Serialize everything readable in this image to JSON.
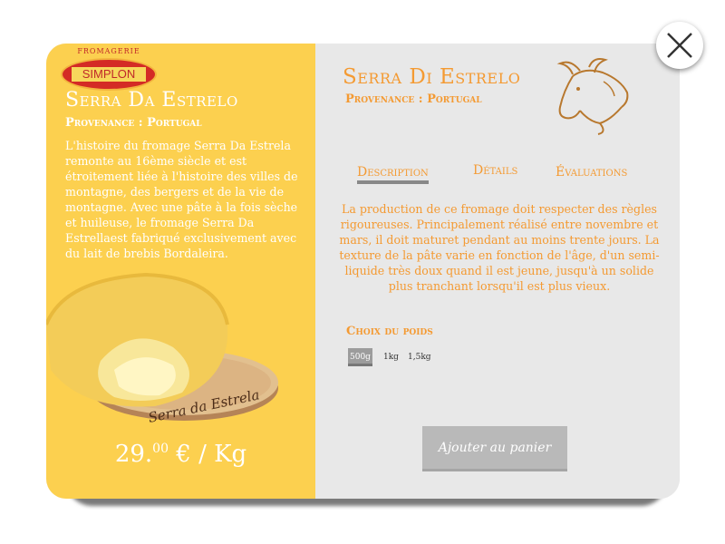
{
  "brand": {
    "logo_top": "FROMAGERIE",
    "logo_name": "SIMPLON"
  },
  "product": {
    "left_title": "Serra Da Estrelo",
    "left_subtitle": "Provenance : Portugal",
    "left_description": "L'histoire du fromage Serra Da Estrela remonte au 16ème siècle et est étroitement liée à l'histoire des villes de montagne, des bergers et de la vie de montagne. Avec une pâte à la fois  sèche et huileuse, le fromage Serra Da Estrellaest fabriqué exclusivement avec du lait de brebis Bordaleira.",
    "board_text": "Serra da Estrela",
    "price_int": "29.",
    "price_dec": "00",
    "price_unit": " € / Kg",
    "right_title": "Serra Di Estrelo",
    "right_subtitle": "Provenance : Portugal",
    "right_description": "La production de ce fromage doit respecter des règles rigoureuses. Principalement  réalisé entre novembre et mars, il doit maturet pendant au moins trente jours. La texture de la pâte varie en fonction de l'âge, d'un semi-liquide très doux quand il est jeune, jusqu'à un solide plus tranchant lorsqu'il est plus vieux."
  },
  "tabs": [
    {
      "label": "Description",
      "active": true
    },
    {
      "label": "Détails",
      "active": false
    },
    {
      "label": "Évaluations",
      "active": false
    }
  ],
  "weight": {
    "label": "Choix du poids",
    "options": [
      "500g",
      "1kg",
      "1,5kg"
    ],
    "selected": "500g"
  },
  "cart_button": "Ajouter au panier",
  "icons": {
    "close": "close-icon",
    "goat": "goat-head-icon"
  },
  "colors": {
    "accent": "#f49a32",
    "left_panel": "#fcd04f",
    "right_panel": "#e8e8e8",
    "button": "#b9b9b9"
  }
}
